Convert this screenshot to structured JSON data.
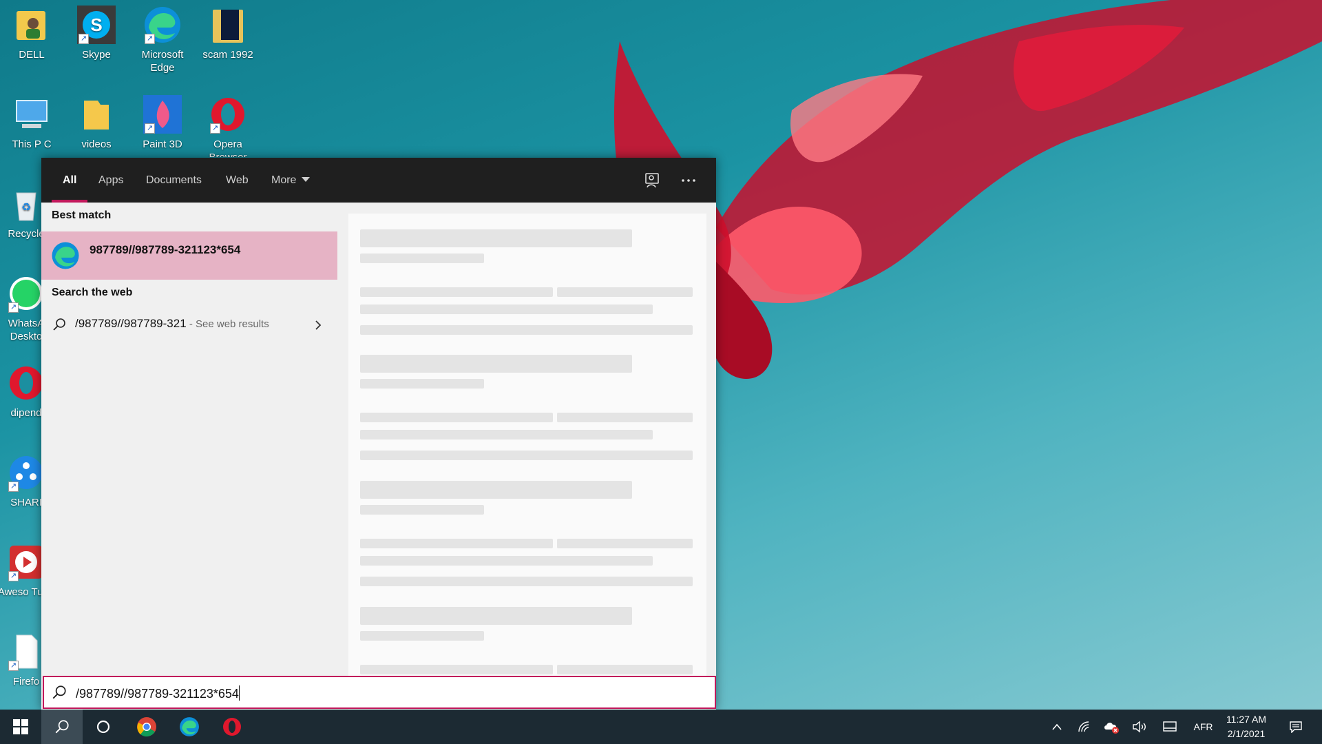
{
  "desktop": {
    "icons": [
      {
        "label": "DELL",
        "icon": "user-folder-icon"
      },
      {
        "label": "Skype",
        "icon": "skype-icon"
      },
      {
        "label": "Microsoft Edge",
        "icon": "edge-icon"
      },
      {
        "label": "scam 1992",
        "icon": "video-file-icon"
      },
      {
        "label": "This P  C",
        "icon": "this-pc-icon"
      },
      {
        "label": "videos",
        "icon": "folder-icon"
      },
      {
        "label": "Paint 3D",
        "icon": "paint3d-icon"
      },
      {
        "label": "Opera Browser",
        "icon": "opera-icon"
      },
      {
        "label": "Recycle",
        "icon": "recycle-bin-icon"
      },
      {
        "label": "WhatsA Deskto",
        "icon": "whatsapp-icon"
      },
      {
        "label": "dipend",
        "icon": "opera-icon"
      },
      {
        "label": "SHARI",
        "icon": "shareit-icon"
      },
      {
        "label": "Aweso Tube",
        "icon": "awesome-tube-icon"
      },
      {
        "label": "Firefo",
        "icon": "document-icon"
      }
    ]
  },
  "search": {
    "tabs": [
      "All",
      "Apps",
      "Documents",
      "Web",
      "More"
    ],
    "active_tab": "All",
    "best_match_heading": "Best match",
    "best_match_title": "987789//987789-321123*654",
    "search_web_heading": "Search the web",
    "web_query": "/987789//987789-321",
    "web_separator": " - ",
    "web_suffix": "See web results",
    "query_value": "/987789//987789-321123*654"
  },
  "taskbar": {
    "language": "AFR",
    "time": "11:27 AM",
    "date": "2/1/2021"
  },
  "colors": {
    "accent": "#c1185b",
    "best_match_bg": "#e6b3c5",
    "taskbar_bg": "#1c2a33"
  }
}
